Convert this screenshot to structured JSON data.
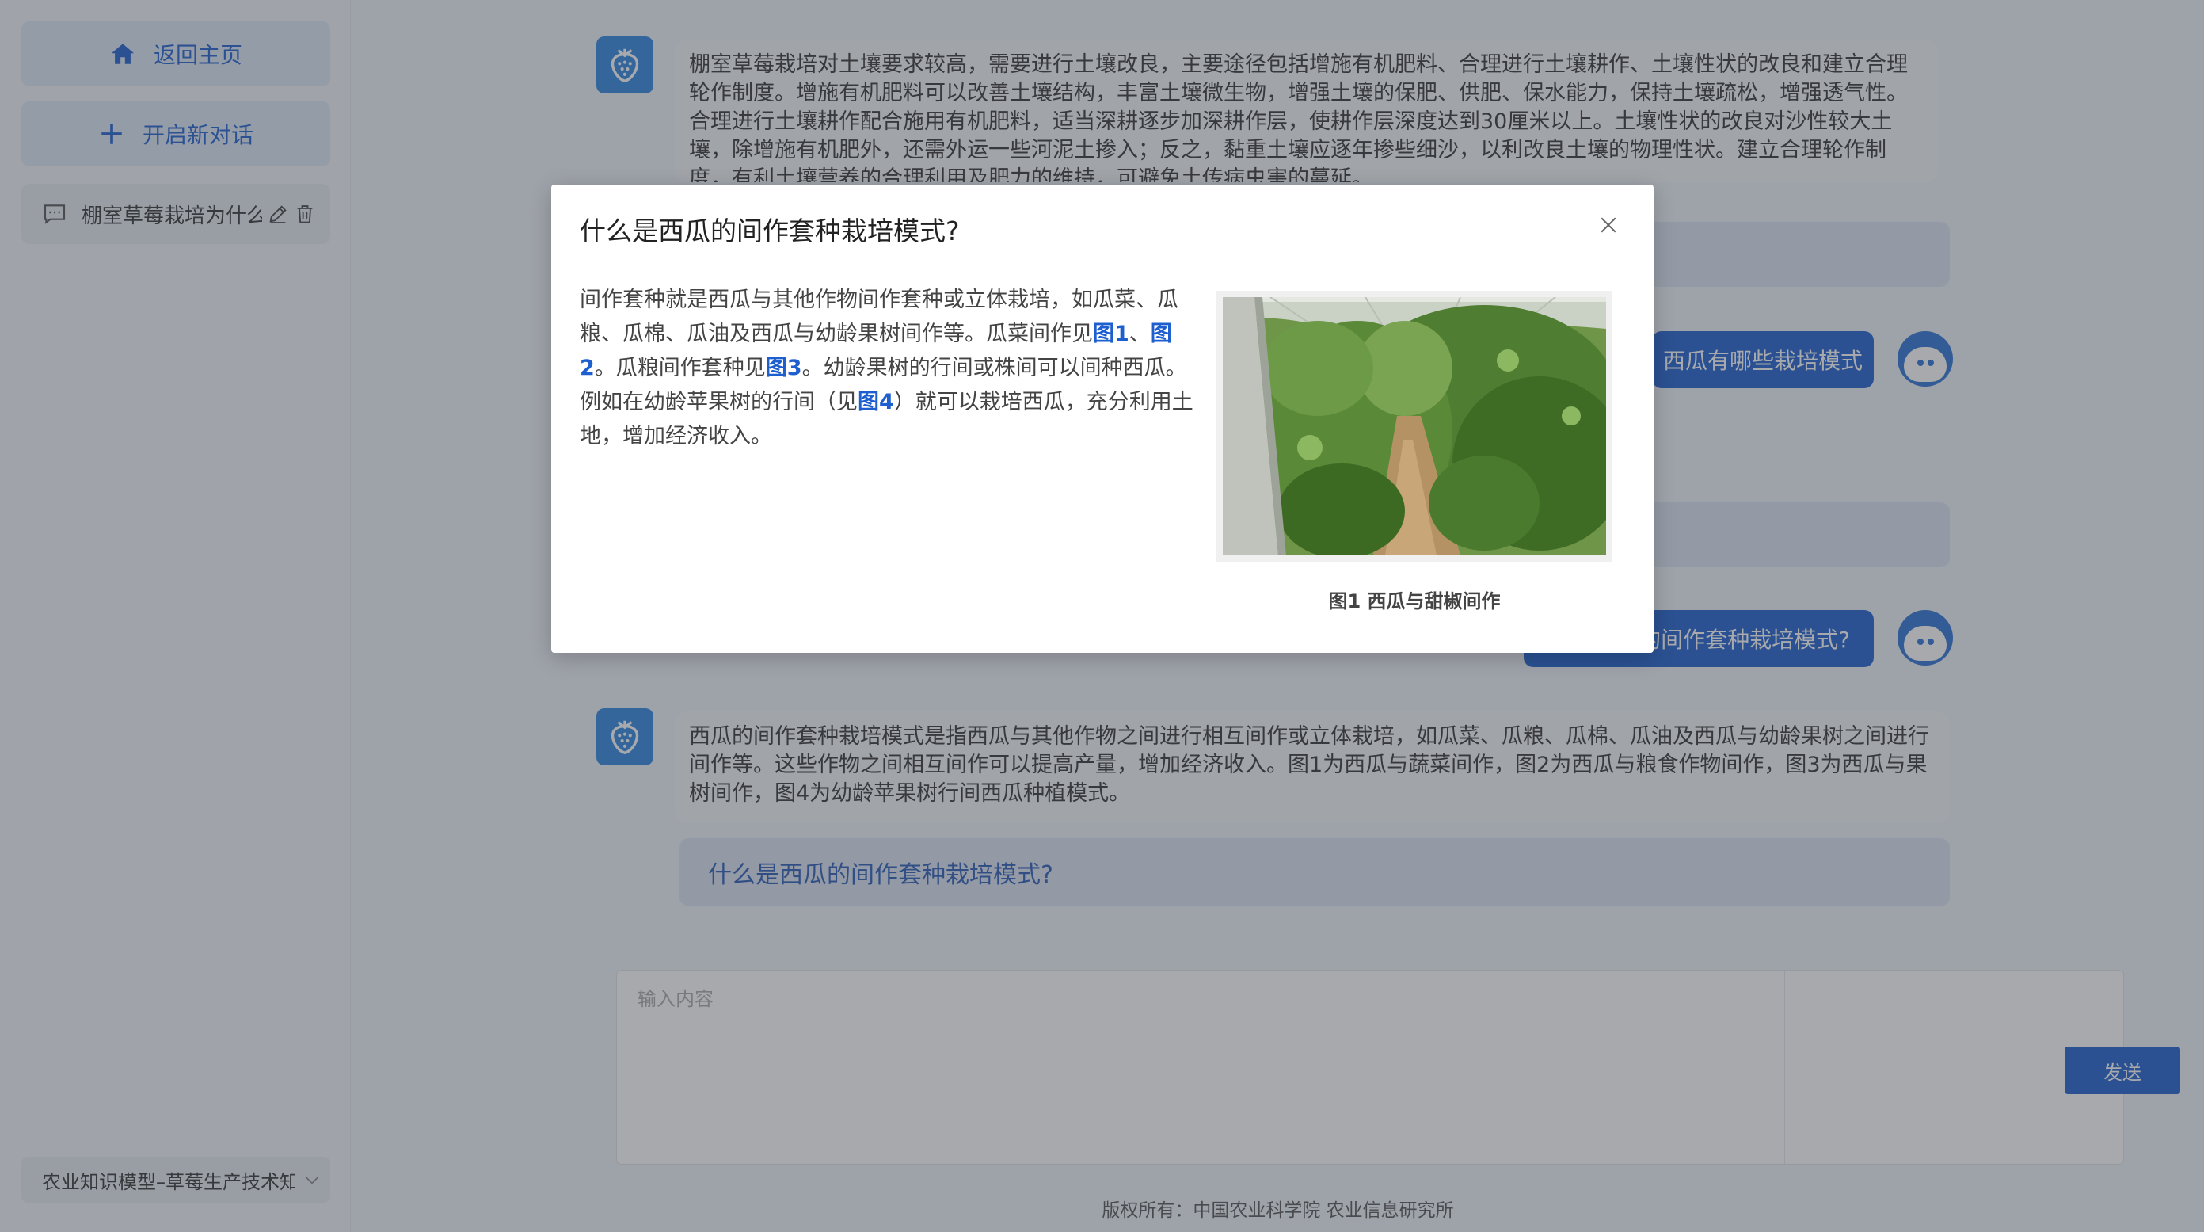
{
  "sidebar": {
    "home_label": "返回主页",
    "new_chat_label": "开启新对话",
    "history": [
      {
        "label": "棚室草莓栽培为什么"
      }
    ],
    "model_label": "农业知识模型–草莓生产技术知"
  },
  "chat": {
    "bot_message_1": "棚室草莓栽培对土壤要求较高，需要进行土壤改良，主要途径包括增施有机肥料、合理进行土壤耕作、土壤性状的改良和建立合理轮作制度。增施有机肥料可以改善土壤结构，丰富土壤微生物，增强土壤的保肥、供肥、保水能力，保持土壤疏松，增强透气性。合理进行土壤耕作配合施用有机肥料，适当深耕逐步加深耕作层，使耕作层深度达到30厘米以上。土壤性状的改良对沙性较大土壤，除增施有机肥外，还需外运一些河泥土掺入；反之，黏重土壤应逐年掺些细沙，以利改良土壤的物理性状。建立合理轮作制度，有利土壤营养的合理利用及肥力的维持，可避免土传病虫害的蔓延。",
    "user_message_1": "西瓜有哪些栽培模式",
    "user_message_2": "什么是西瓜的间作套种栽培模式?",
    "bot_message_2": "西瓜的间作套种栽培模式是指西瓜与其他作物之间进行相互间作或立体栽培，如瓜菜、瓜粮、瓜棉、瓜油及西瓜与幼龄果树之间进行间作等。这些作物之间相互间作可以提高产量，增加经济收入。图1为西瓜与蔬菜间作，图2为西瓜与粮食作物间作，图3为西瓜与果树间作，图4为幼龄苹果树行间西瓜种植模式。",
    "suggestion": "什么是西瓜的间作套种栽培模式?"
  },
  "input": {
    "placeholder": "输入内容",
    "send_label": "发送"
  },
  "footer": {
    "copyright": "版权所有：中国农业科学院 农业信息研究所"
  },
  "modal": {
    "title": "什么是西瓜的间作套种栽培模式?",
    "text_1": "间作套种就是西瓜与其他作物间作套种或立体栽培，如瓜菜、瓜粮、瓜棉、瓜油及西瓜与幼龄果树间作等。瓜菜间作见",
    "ref_1": "图1",
    "sep_1": "、",
    "ref_2": "图2",
    "text_2": "。瓜粮间作套种见",
    "ref_3": "图3",
    "text_3": "。幼龄果树的行间或株间可以间种西瓜。例如在幼龄苹果树的行间（见",
    "ref_4": "图4",
    "text_4": "）就可以栽培西瓜，充分利用土地，增加经济收入。",
    "caption": "图1 西瓜与甜椒间作"
  },
  "colors": {
    "accent": "#1e5fd0",
    "sidebar_button": "#dde8f8",
    "overlay": "#3c4048"
  },
  "icons": [
    "home-icon",
    "plus-icon",
    "chat-icon",
    "edit-icon",
    "trash-icon",
    "chevron-down-icon",
    "strawberry-icon",
    "user-avatar-icon",
    "close-icon"
  ]
}
